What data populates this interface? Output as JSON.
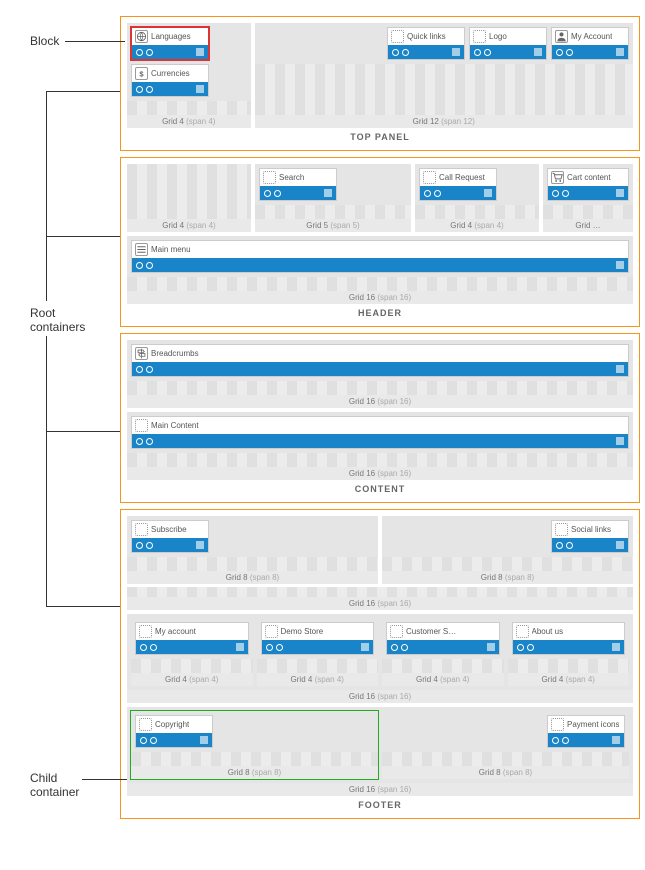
{
  "annotations": {
    "block": "Block",
    "root": "Root\ncontainers",
    "child": "Child\ncontainer"
  },
  "panels": {
    "top": {
      "title": "TOP PANEL",
      "grid4": "Grid 4",
      "grid4_span": "(span 4)",
      "grid12": "Grid 12",
      "grid12_span": "(span 12)",
      "languages": "Languages",
      "currencies": "Currencies",
      "quicklinks": "Quick links",
      "logo": "Logo",
      "myaccount": "My Account"
    },
    "header": {
      "title": "HEADER",
      "grid4": "Grid 4",
      "grid4_span": "(span 4)",
      "grid5": "Grid 5",
      "grid5_span": "(span 5)",
      "gridr": "Grid …",
      "grid16": "Grid 16",
      "grid16_span": "(span 16)",
      "search": "Search",
      "call": "Call Request",
      "cart": "Cart content",
      "mainmenu": "Main menu"
    },
    "content": {
      "title": "CONTENT",
      "grid16": "Grid 16",
      "grid16_span": "(span 16)",
      "breadcrumbs": "Breadcrumbs",
      "main": "Main Content"
    },
    "footer": {
      "title": "FOOTER",
      "grid8": "Grid 8",
      "grid8_span": "(span 8)",
      "grid4": "Grid 4",
      "grid4_span": "(span 4)",
      "grid16": "Grid 16",
      "grid16_span": "(span 16)",
      "subscribe": "Subscribe",
      "social": "Social links",
      "myacc": "My account",
      "demo": "Demo Store",
      "customer": "Customer S…",
      "about": "About us",
      "copyright": "Copyright",
      "payment": "Payment icons"
    }
  }
}
